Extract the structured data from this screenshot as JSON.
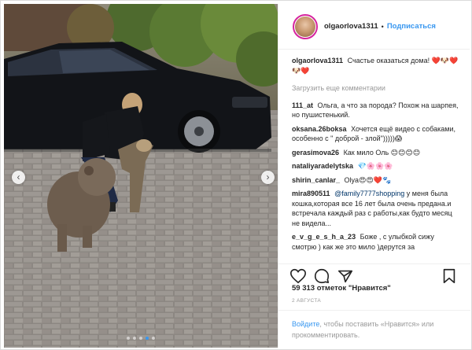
{
  "post": {
    "username": "olgaorlova1311",
    "separator": "•",
    "follow_label": "Подписаться",
    "caption_user": "olgaorlova1311",
    "caption_text": "Счастье оказаться дома! ❤️🐶❤️🐶❤️",
    "load_more": "Загрузить еще комментарии",
    "likes": "59 313 отметок \"Нравится\"",
    "date": "2 АВГУСТА",
    "login_link": "Войдите",
    "login_text": ", чтобы поставить «Нравится» или прокомментировать."
  },
  "comments": [
    {
      "user": "111_at",
      "text": "Ольга, а что за порода? Похож на шарпея, но пушистенький."
    },
    {
      "user": "oksana.26boksa",
      "text": "Хочется ещё видео с собаками, особенно с \" доброй - злой\")))))😱"
    },
    {
      "user": "gerasimova26",
      "text": "Как мило Оль 😊😊😊😊"
    },
    {
      "user": "nataliyaradelytska",
      "text": "💎🌸🌸🌸"
    },
    {
      "user": "shirin_canlar_",
      "text": "Olya😍😍❤️🐾"
    },
    {
      "user": "mira890511",
      "mention": "@family7777shopping",
      "text": " у меня была кошка,которая все 16 лет была очень предана.и встречала каждый раз с работы,как будто месяц не видела..."
    },
    {
      "user": "e_v_g_e_s_h_a_23",
      "text": "Боже , с улыбкой сижу смотрю ) как же это мило )дерутся за"
    }
  ],
  "icons": [
    "chevron-left-icon",
    "chevron-right-icon",
    "heart-icon",
    "comment-icon",
    "share-icon",
    "bookmark-icon"
  ],
  "colors": {
    "accent": "#3897f0",
    "text": "#262626",
    "muted": "#999999",
    "border": "#efefef"
  },
  "carousel": {
    "slides": 5,
    "active_index": 3
  }
}
